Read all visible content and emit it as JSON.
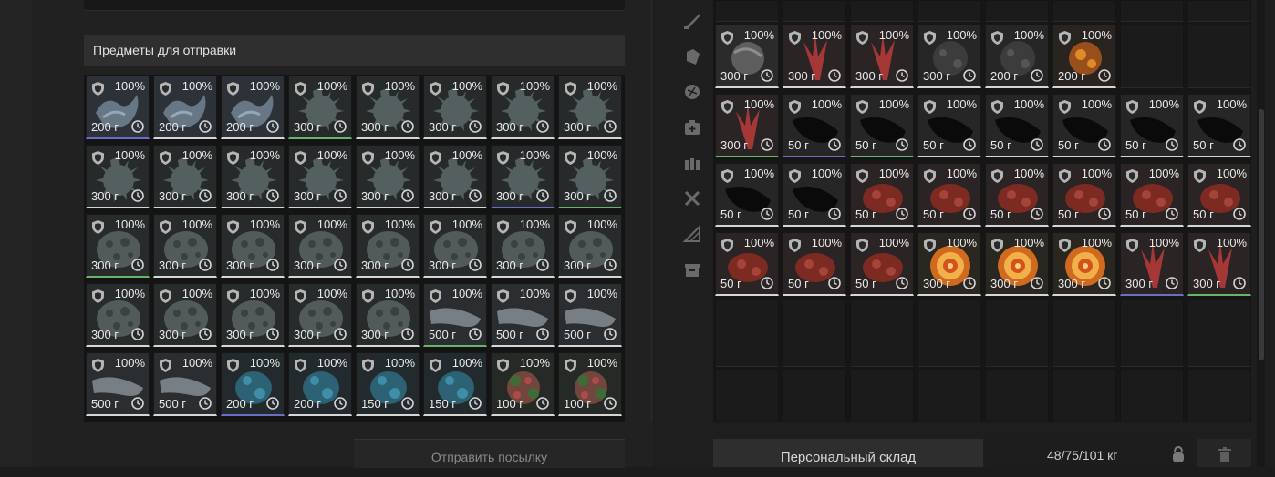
{
  "send_section": {
    "title": "Предметы для отправки",
    "items": [
      {
        "pct": "100%",
        "weight": "200 г",
        "art": "crystal",
        "border": "blue"
      },
      {
        "pct": "100%",
        "weight": "200 г",
        "art": "crystal",
        "border": "white"
      },
      {
        "pct": "100%",
        "weight": "200 г",
        "art": "crystal",
        "border": "white"
      },
      {
        "pct": "100%",
        "weight": "300 г",
        "art": "spiky",
        "border": "green"
      },
      {
        "pct": "100%",
        "weight": "300 г",
        "art": "spiky",
        "border": "white"
      },
      {
        "pct": "100%",
        "weight": "300 г",
        "art": "spiky",
        "border": "white"
      },
      {
        "pct": "100%",
        "weight": "300 г",
        "art": "spiky",
        "border": "white"
      },
      {
        "pct": "100%",
        "weight": "300 г",
        "art": "spiky",
        "border": "white"
      },
      {
        "pct": "100%",
        "weight": "300 г",
        "art": "spiky",
        "border": "white"
      },
      {
        "pct": "100%",
        "weight": "300 г",
        "art": "spiky",
        "border": "white"
      },
      {
        "pct": "100%",
        "weight": "300 г",
        "art": "spiky",
        "border": "white"
      },
      {
        "pct": "100%",
        "weight": "300 г",
        "art": "spiky",
        "border": "white"
      },
      {
        "pct": "100%",
        "weight": "300 г",
        "art": "spiky",
        "border": "white"
      },
      {
        "pct": "100%",
        "weight": "300 г",
        "art": "spiky",
        "border": "white"
      },
      {
        "pct": "100%",
        "weight": "300 г",
        "art": "spiky",
        "border": "blue"
      },
      {
        "pct": "100%",
        "weight": "300 г",
        "art": "spiky",
        "border": "green"
      },
      {
        "pct": "100%",
        "weight": "300 г",
        "art": "rock",
        "border": "green"
      },
      {
        "pct": "100%",
        "weight": "300 г",
        "art": "rock",
        "border": "white"
      },
      {
        "pct": "100%",
        "weight": "300 г",
        "art": "rock",
        "border": "white"
      },
      {
        "pct": "100%",
        "weight": "300 г",
        "art": "rock",
        "border": "white"
      },
      {
        "pct": "100%",
        "weight": "300 г",
        "art": "rock",
        "border": "white"
      },
      {
        "pct": "100%",
        "weight": "300 г",
        "art": "rock",
        "border": "white"
      },
      {
        "pct": "100%",
        "weight": "300 г",
        "art": "rock",
        "border": "white"
      },
      {
        "pct": "100%",
        "weight": "300 г",
        "art": "rock",
        "border": "white"
      },
      {
        "pct": "100%",
        "weight": "300 г",
        "art": "rock",
        "border": "white"
      },
      {
        "pct": "100%",
        "weight": "300 г",
        "art": "rock",
        "border": "white"
      },
      {
        "pct": "100%",
        "weight": "300 г",
        "art": "rock",
        "border": "white"
      },
      {
        "pct": "100%",
        "weight": "300 г",
        "art": "rock",
        "border": "white"
      },
      {
        "pct": "100%",
        "weight": "300 г",
        "art": "rock",
        "border": "white"
      },
      {
        "pct": "100%",
        "weight": "500 г",
        "art": "bone",
        "border": "green"
      },
      {
        "pct": "100%",
        "weight": "500 г",
        "art": "bone",
        "border": "white"
      },
      {
        "pct": "100%",
        "weight": "500 г",
        "art": "bone",
        "border": "white"
      },
      {
        "pct": "100%",
        "weight": "500 г",
        "art": "bone",
        "border": "white"
      },
      {
        "pct": "100%",
        "weight": "500 г",
        "art": "bone",
        "border": "white"
      },
      {
        "pct": "100%",
        "weight": "200 г",
        "art": "blue",
        "border": "blue"
      },
      {
        "pct": "100%",
        "weight": "200 г",
        "art": "blue",
        "border": "white"
      },
      {
        "pct": "100%",
        "weight": "150 г",
        "art": "blue",
        "border": "white"
      },
      {
        "pct": "100%",
        "weight": "150 г",
        "art": "blue",
        "border": "white"
      },
      {
        "pct": "100%",
        "weight": "100 г",
        "art": "flower",
        "border": "white"
      },
      {
        "pct": "100%",
        "weight": "100 г",
        "art": "flower",
        "border": "white"
      }
    ]
  },
  "storage": {
    "rows": [
      [
        {
          "pct": "100%",
          "weight": "300 г",
          "art": "grey",
          "border": "white"
        },
        {
          "pct": "100%",
          "weight": "300 г",
          "art": "red",
          "border": "white"
        },
        {
          "pct": "100%",
          "weight": "300 г",
          "art": "red",
          "border": "white"
        },
        {
          "pct": "100%",
          "weight": "300 г",
          "art": "dark",
          "border": "white"
        },
        {
          "pct": "100%",
          "weight": "200 г",
          "art": "dark",
          "border": "white"
        },
        {
          "pct": "100%",
          "weight": "200 г",
          "art": "fire",
          "border": "white"
        }
      ],
      [
        {
          "pct": "100%",
          "weight": "300 г",
          "art": "red",
          "border": "green"
        },
        {
          "pct": "100%",
          "weight": "50 г",
          "art": "black",
          "border": "blue"
        },
        {
          "pct": "100%",
          "weight": "50 г",
          "art": "black",
          "border": "green"
        },
        {
          "pct": "100%",
          "weight": "50 г",
          "art": "black",
          "border": "white"
        },
        {
          "pct": "100%",
          "weight": "50 г",
          "art": "black",
          "border": "white"
        },
        {
          "pct": "100%",
          "weight": "50 г",
          "art": "black",
          "border": "white"
        },
        {
          "pct": "100%",
          "weight": "50 г",
          "art": "black",
          "border": "white"
        },
        {
          "pct": "100%",
          "weight": "50 г",
          "art": "black",
          "border": "white"
        }
      ],
      [
        {
          "pct": "100%",
          "weight": "50 г",
          "art": "black",
          "border": "white"
        },
        {
          "pct": "100%",
          "weight": "50 г",
          "art": "black",
          "border": "white"
        },
        {
          "pct": "100%",
          "weight": "50 г",
          "art": "meat",
          "border": "white"
        },
        {
          "pct": "100%",
          "weight": "50 г",
          "art": "meat",
          "border": "white"
        },
        {
          "pct": "100%",
          "weight": "50 г",
          "art": "meat",
          "border": "white"
        },
        {
          "pct": "100%",
          "weight": "50 г",
          "art": "meat",
          "border": "white"
        },
        {
          "pct": "100%",
          "weight": "50 г",
          "art": "meat",
          "border": "white"
        },
        {
          "pct": "100%",
          "weight": "50 г",
          "art": "meat",
          "border": "white"
        }
      ],
      [
        {
          "pct": "100%",
          "weight": "50 г",
          "art": "meat",
          "border": "white"
        },
        {
          "pct": "100%",
          "weight": "50 г",
          "art": "meat",
          "border": "white"
        },
        {
          "pct": "100%",
          "weight": "50 г",
          "art": "meat",
          "border": "white"
        },
        {
          "pct": "100%",
          "weight": "300 г",
          "art": "swirl",
          "border": "white"
        },
        {
          "pct": "100%",
          "weight": "300 г",
          "art": "swirl",
          "border": "white"
        },
        {
          "pct": "100%",
          "weight": "300 г",
          "art": "swirl",
          "border": "white"
        },
        {
          "pct": "100%",
          "weight": "300 г",
          "art": "red",
          "border": "blue"
        },
        {
          "pct": "100%",
          "weight": "300 г",
          "art": "red",
          "border": "green"
        }
      ]
    ]
  },
  "tabs": [
    {
      "icon": "knife-icon"
    },
    {
      "icon": "armor-icon"
    },
    {
      "icon": "artifact-icon"
    },
    {
      "icon": "medkit-icon"
    },
    {
      "icon": "ammo-icon"
    },
    {
      "icon": "tools-icon"
    },
    {
      "icon": "blueprint-icon"
    },
    {
      "icon": "box-icon"
    }
  ],
  "footer": {
    "send_button": "Отправить посылку",
    "storage_button": "Персональный склад",
    "weight": "48/75/101 кг"
  },
  "colors": {
    "border_white": "#d6d6d6",
    "border_blue": "#6a6ec6",
    "border_green": "#68b46a"
  }
}
